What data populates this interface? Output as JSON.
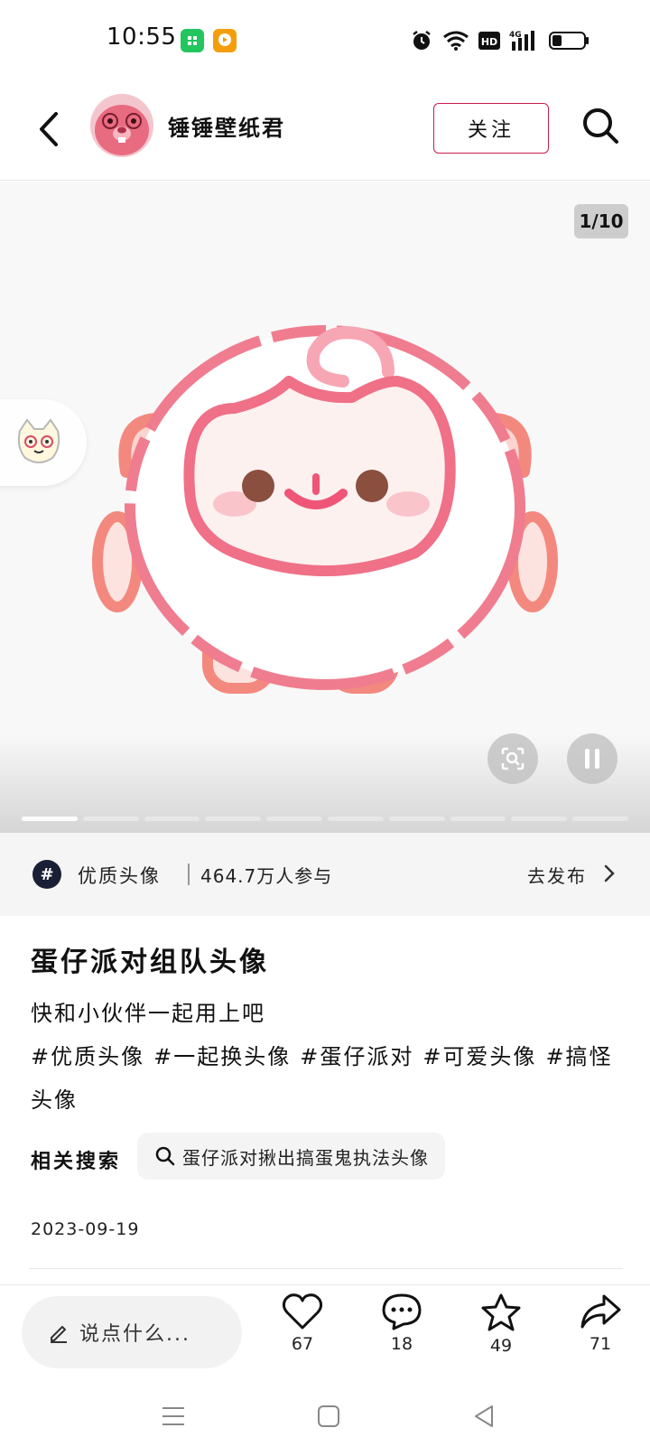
{
  "status_bar": {
    "time": "10:55",
    "battery_level": 0.3,
    "network_label": "4G",
    "hd_label": "HD"
  },
  "header": {
    "author_name": "锤锤壁纸君",
    "follow_label": "关注"
  },
  "image": {
    "counter": "1/10",
    "current_index": 1,
    "total": 10,
    "icon": "cute-pink-mascot-avatar"
  },
  "topic": {
    "name": "优质头像",
    "participants": "464.7万人参与",
    "go_publish": "去发布"
  },
  "post": {
    "title": "蛋仔派对组队头像",
    "description": "快和小伙伴一起用上吧",
    "tags": [
      "#优质头像",
      "#一起换头像",
      "#蛋仔派对",
      "#可爱头像",
      "#搞怪头像"
    ],
    "related_label": "相关搜索",
    "related_query": "蛋仔派对揪出搞蛋鬼执法头像",
    "date": "2023-09-19"
  },
  "actions": {
    "comment_placeholder": "说点什么...",
    "like_count": "67",
    "comment_count": "18",
    "favorite_count": "49",
    "share_count": "71"
  },
  "colors": {
    "accent": "#c51f4b",
    "mascot_pink": "#f06b85",
    "topic_bg": "#f5f5f5"
  }
}
